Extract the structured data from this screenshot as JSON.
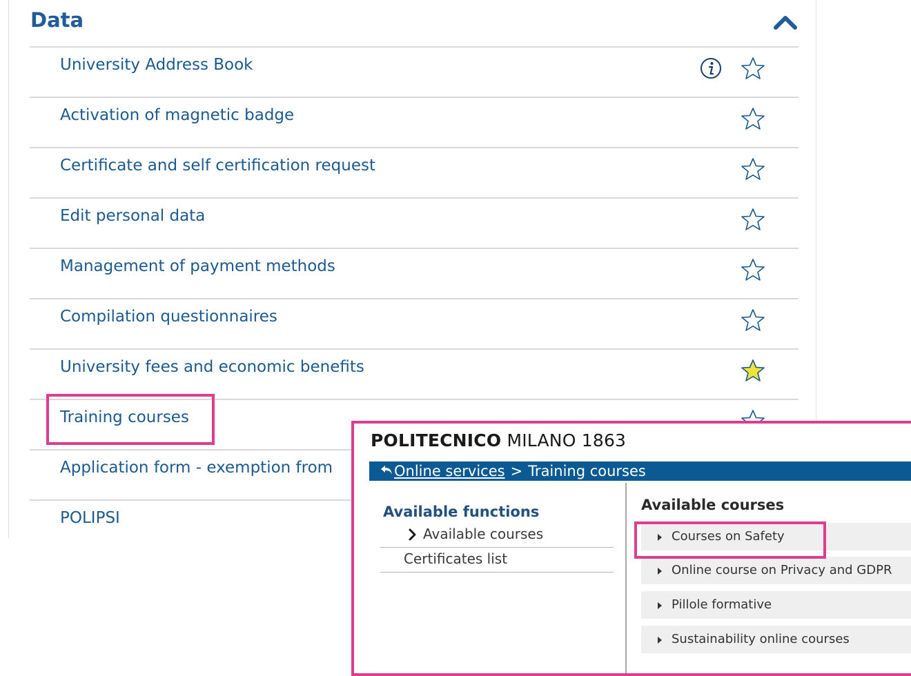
{
  "data_section": {
    "title": "Data",
    "items": [
      {
        "label": "University Address Book",
        "favorite": false,
        "info": true
      },
      {
        "label": "Activation of magnetic badge",
        "favorite": false
      },
      {
        "label": "Certificate and self certification request",
        "favorite": false
      },
      {
        "label": "Edit personal data",
        "favorite": false
      },
      {
        "label": "Management of payment methods",
        "favorite": false
      },
      {
        "label": "Compilation questionnaires",
        "favorite": false
      },
      {
        "label": "University fees and economic benefits",
        "favorite": true
      },
      {
        "label": "Training courses",
        "favorite": false
      },
      {
        "label": "Application form - exemption from",
        "favorite": false
      },
      {
        "label": "POLIPSI",
        "favorite": false
      }
    ]
  },
  "inset": {
    "brand_bold": "POLITECNICO",
    "brand_rest": " MILANO 1863",
    "breadcrumb": {
      "link": "Online services",
      "separator": ">",
      "current": "Training courses"
    },
    "functions_title": "Available functions",
    "functions": [
      {
        "label": "Available courses",
        "active": true
      },
      {
        "label": "Certificates list",
        "active": false
      }
    ],
    "courses_title": "Available courses",
    "courses": [
      {
        "label": "Courses on Safety"
      },
      {
        "label": "Online course on Privacy and GDPR"
      },
      {
        "label": "Pillole formative"
      },
      {
        "label": "Sustainability online courses"
      }
    ]
  },
  "colors": {
    "link_blue": "#1c5a8f",
    "title_blue": "#1f5c99",
    "highlight_pink": "#de3d8f",
    "star_gold": "#f2e23a",
    "breadcrumb_bar": "#0c5a93"
  }
}
